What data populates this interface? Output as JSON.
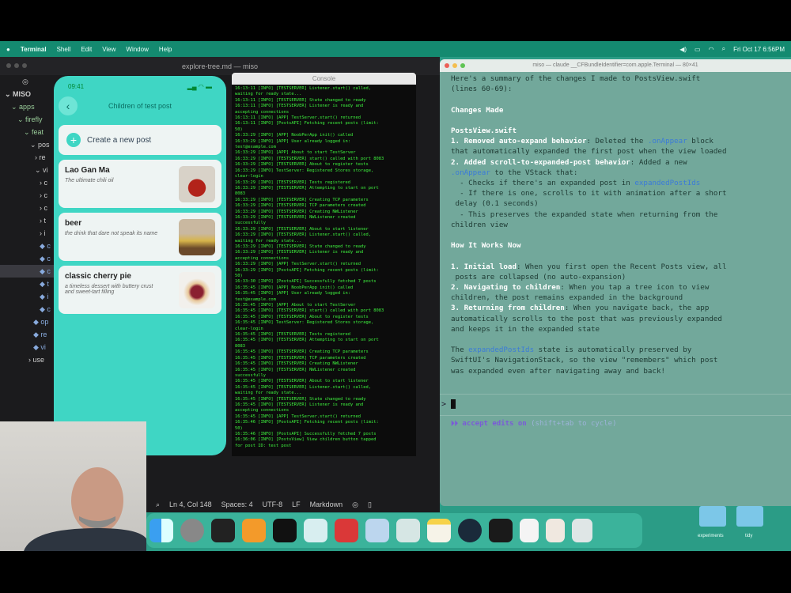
{
  "menubar": {
    "app": "Terminal",
    "items": [
      "Shell",
      "Edit",
      "View",
      "Window",
      "Help"
    ],
    "clock": "Fri Oct 17 6:56PM"
  },
  "vscode": {
    "title": "explore-tree.md — miso",
    "tree": [
      "MISO",
      "apps",
      "firefly",
      "feat",
      "pos",
      "re",
      "vi",
      "c",
      "c",
      "c",
      "t",
      "i",
      "c",
      "c",
      "c",
      "t",
      "i",
      "c",
      "op",
      "re",
      "vi",
      "use"
    ],
    "status": {
      "position": "Ln 4, Col 148",
      "spaces": "Spaces: 4",
      "encoding": "UTF-8",
      "eol": "LF",
      "language": "Markdown"
    }
  },
  "phone": {
    "time": "09:41",
    "title": "Children of test post",
    "create_label": "Create a new post",
    "posts": [
      {
        "title": "Lao Gan Ma",
        "desc": "The ultimate chili oil"
      },
      {
        "title": "beer",
        "desc": "the drink that dare not speak its name"
      },
      {
        "title": "classic cherry pie",
        "desc": "a timeless dessert with buttery crust and sweet-tart filling"
      }
    ]
  },
  "console": {
    "title": "Console",
    "log": "16:13:11 [INFO] [TESTSERVER] Listener.start() called,\nwaiting for ready state...\n16:13:11 [INFO] [TESTSERVER] State changed to ready\n16:13:11 [INFO] [TESTSERVER] Listener is ready and\naccepting connections\n16:13:11 [INFO] [APP] TestServer.start() returned\n16:13:11 [INFO] [PostsAPI] Fetching recent posts (limit:\n50)\n16:33:29 [INFO] [APP] NoobPerApp init() called\n16:33:29 [INFO] [APP] User already logged in:\ntest@example.com\n16:33:29 [INFO] [APP] About to start TestServer\n16:33:29 [INFO] [TESTSERVER] start() called with port 8083\n16:33:29 [INFO] [TESTSERVER] About to register tests\n16:33:29 [INFO] TestServer: Registered Stores storage,\nclear-login\n16:33:29 [INFO] [TESTSERVER] Tests registered\n16:33:29 [INFO] [TESTSERVER] Attempting to start on port\n8083\n16:33:29 [INFO] [TESTSERVER] Creating TCP parameters\n16:33:29 [INFO] [TESTSERVER] TCP parameters created\n16:33:29 [INFO] [TESTSERVER] Creating NWListener\n16:33:29 [INFO] [TESTSERVER] NWListener created\nsuccessfully\n16:33:29 [INFO] [TESTSERVER] About to start listener\n16:33:29 [INFO] [TESTSERVER] Listener.start() called,\nwaiting for ready state...\n16:33:29 [INFO] [TESTSERVER] State changed to ready\n16:33:29 [INFO] [TESTSERVER] Listener is ready and\naccepting connections\n16:33:29 [INFO] [APP] TestServer.start() returned\n16:33:29 [INFO] [PostsAPI] Fetching recent posts (limit:\n50)\n16:33:30 [INFO] [PostsAPI] Successfully fetched 7 posts\n16:35:45 [INFO] [APP] NoobPerApp init() called\n16:35:45 [INFO] [APP] User already logged in:\ntest@example.com\n16:35:45 [INFO] [APP] About to start TestServer\n16:35:45 [INFO] [TESTSERVER] start() called with port 8083\n16:35:45 [INFO] [TESTSERVER] About to register tests\n16:35:45 [INFO] TestServer: Registered Stores storage,\nclear-login\n16:35:45 [INFO] [TESTSERVER] Tests registered\n16:35:45 [INFO] [TESTSERVER] Attempting to start on port\n8083\n16:35:45 [INFO] [TESTSERVER] Creating TCP parameters\n16:35:45 [INFO] [TESTSERVER] TCP parameters created\n16:35:45 [INFO] [TESTSERVER] Creating NWListener\n16:35:45 [INFO] [TESTSERVER] NWListener created\nsuccessfully\n16:35:45 [INFO] [TESTSERVER] About to start listener\n16:35:45 [INFO] [TESTSERVER] Listener.start() called,\nwaiting for ready state...\n16:35:45 [INFO] [TESTSERVER] State changed to ready\n16:35:45 [INFO] [TESTSERVER] Listener is ready and\naccepting connections\n16:35:45 [INFO] [APP] TestServer.start() returned\n16:35:46 [INFO] [PostsAPI] Fetching recent posts (limit:\n50)\n16:35:46 [INFO] [PostsAPI] Successfully fetched 7 posts\n16:36:06 [INFO] [PostsView] View children button tapped\nfor post ID: test post"
  },
  "terminal": {
    "title": "miso — claude __CFBundleIdentifier=com.apple.Terminal — 80×41",
    "intro": "Here's a summary of the changes I made to PostsView.swift\n(lines 60-69):",
    "h1": "Changes Made",
    "file": "PostsView.swift",
    "c1_b": "1. Removed auto-expand behavior",
    "c1_a": ": Deleted the ",
    "c1_code": ".onAppear",
    "c1_c": " block\nthat automatically expanded the first post when the view loaded",
    "c2_b": "2. Added scroll-to-expanded-post behavior",
    "c2_a": ": Added a new\n",
    "c2_code": ".onAppear",
    "c2_c": " to the VStack that:\n  - Checks if there's an expanded post in ",
    "c2_code2": "expandedPostIds",
    "c2_d": "\n  - If there is one, scrolls to it with animation after a short\n delay (0.1 seconds)\n  - This preserves the expanded state when returning from the\nchildren view",
    "h2": "How It Works Now",
    "w1_b": "1. Initial load",
    "w1": ": When you first open the Recent Posts view, all\n posts are collapsed (no auto-expansion)",
    "w2_b": "2. Navigating to children",
    "w2": ": When you tap a tree icon to view\nchildren, the post remains expanded in the background",
    "w3_b": "3. Returning from children",
    "w3": ": When you navigate back, the app\nautomatically scrolls to the post that was previously expanded\nand keeps it in the expanded state",
    "o_a": "The ",
    "o_code": "expandedPostIds",
    "o_b": " state is automatically preserved by\nSwiftUI's NavigationStack, so the view \"remembers\" which post\nwas expanded even after navigating away and back!",
    "prompt": ">",
    "mode": "⏵⏵ accept edits on",
    "mode_hint": "(shift+tab to cycle)"
  },
  "desktop": {
    "folders": [
      "experiments",
      "tidy"
    ]
  },
  "colors": {
    "menubar": "#148a70",
    "desktop": "#2b9c86",
    "terminal_bg": "#72a89b",
    "phone_bg": "#3fd6c4",
    "console_text": "#3ef23e"
  }
}
